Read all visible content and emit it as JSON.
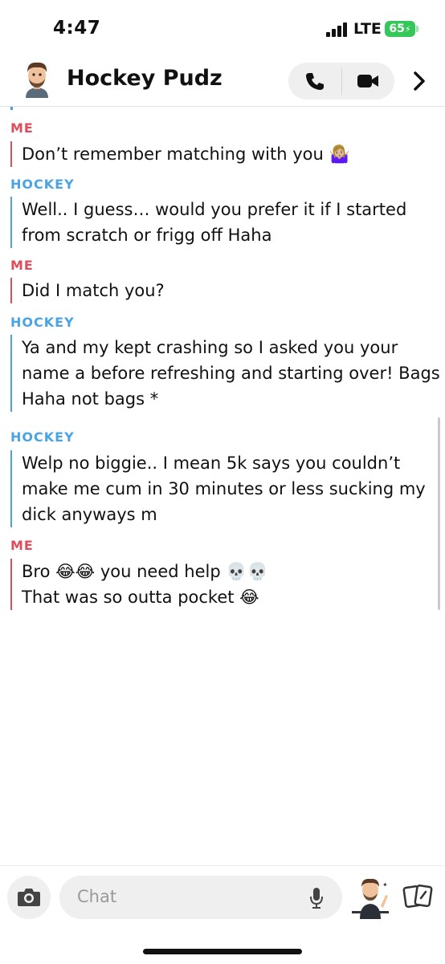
{
  "status_bar": {
    "time": "4:47",
    "network": "LTE",
    "battery": "65"
  },
  "header": {
    "title": "Hockey Pudz",
    "avatar_icon": "bitmoji-avatar",
    "call_icon": "phone-icon",
    "video_icon": "video-camera-icon",
    "more_icon": "chevron-right-icon"
  },
  "messages": [
    {
      "sender": "ME",
      "lines": [
        "Don’t remember matching with you 🤷🏼‍♀️"
      ]
    },
    {
      "sender": "HOCKEY",
      "lines": [
        "Well.. I guess… would you prefer it if I started",
        "from scratch or frigg off Haha"
      ]
    },
    {
      "sender": "ME",
      "lines": [
        "Did I match you?"
      ]
    },
    {
      "sender": "HOCKEY",
      "lines": [
        "Ya and my kept crashing so I asked you your",
        "name a before refreshing and starting over! Bags",
        "Haha not bags *"
      ]
    },
    {
      "sender": "HOCKEY",
      "lines": [
        "Welp no biggie.. I mean 5k says you couldn’t",
        "make me cum in 30 minutes or less sucking my",
        "dick anyways m"
      ]
    },
    {
      "sender": "ME",
      "lines": [
        "Bro 😂😂 you need help 💀💀",
        "That was so outta pocket 😂"
      ]
    }
  ],
  "composer": {
    "placeholder": "Chat",
    "camera_icon": "camera-icon",
    "mic_icon": "microphone-icon",
    "bitmoji_icon": "bitmoji-icon",
    "cards_icon": "cards-icon"
  },
  "colors": {
    "me": "#e04c5a",
    "hockey": "#4aa3e4",
    "battery": "#34c759"
  }
}
